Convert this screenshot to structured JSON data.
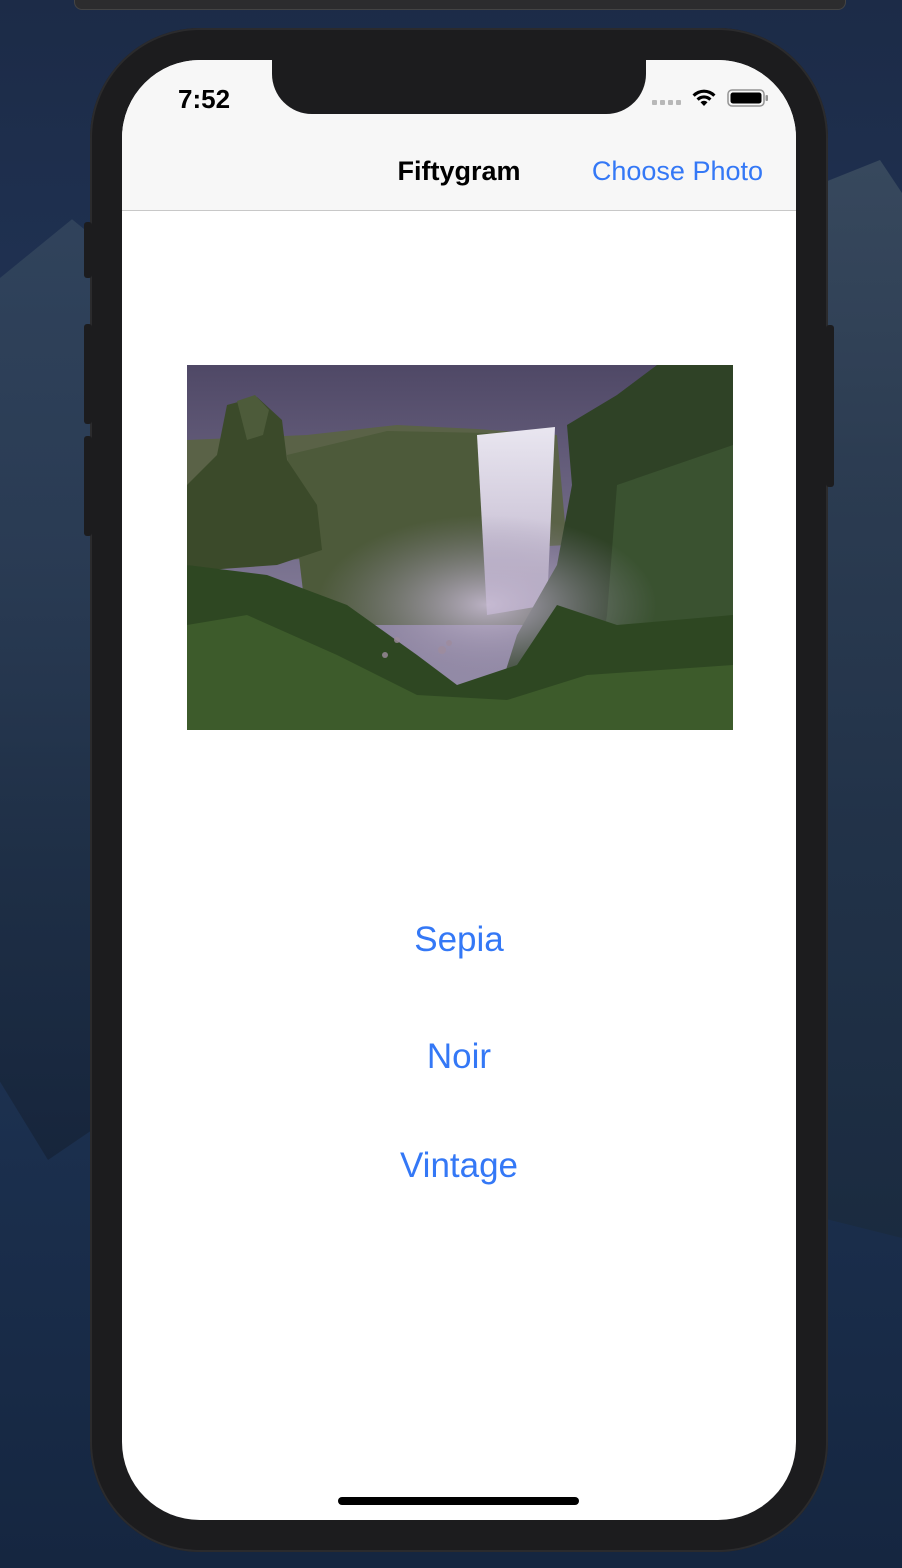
{
  "status_bar": {
    "time": "7:52"
  },
  "nav": {
    "title": "Fiftygram",
    "choose_photo_label": "Choose Photo"
  },
  "photo": {
    "subject": "waterfall-landscape"
  },
  "filters": [
    {
      "label": "Sepia"
    },
    {
      "label": "Noir"
    },
    {
      "label": "Vintage"
    }
  ],
  "colors": {
    "accent": "#3478f6",
    "nav_background": "#f7f7f7",
    "device_frame": "#1c1c1e"
  }
}
